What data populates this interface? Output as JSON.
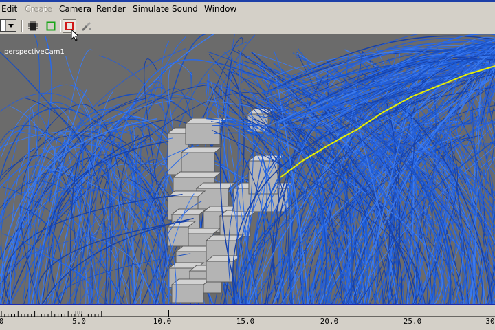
{
  "menubar": {
    "items": [
      {
        "label": "Edit",
        "enabled": true
      },
      {
        "label": "Create",
        "enabled": false
      },
      {
        "label": "Camera",
        "enabled": true
      },
      {
        "label": "Render",
        "enabled": true
      },
      {
        "label": "Simulate",
        "enabled": true
      },
      {
        "label": "Sound",
        "enabled": true
      },
      {
        "label": "Window",
        "enabled": true
      }
    ]
  },
  "toolbar": {
    "icons": [
      "chip-icon",
      "green-square-icon",
      "red-square-icon",
      "paint-brush-icon"
    ]
  },
  "viewport": {
    "camera_label": "perspectiveCam1",
    "background_color": "#6b6b6b",
    "hair_color": "#1f5fd8",
    "selected_strand_color": "#e8f000",
    "block_color": "#b4b4b4"
  },
  "timeline": {
    "tick_labels": [
      "0",
      "5.0",
      "10.0",
      "15.0",
      "20.0",
      "25.0",
      "30"
    ],
    "current_frame": 10.0,
    "border_color": "#1c2bb0"
  }
}
